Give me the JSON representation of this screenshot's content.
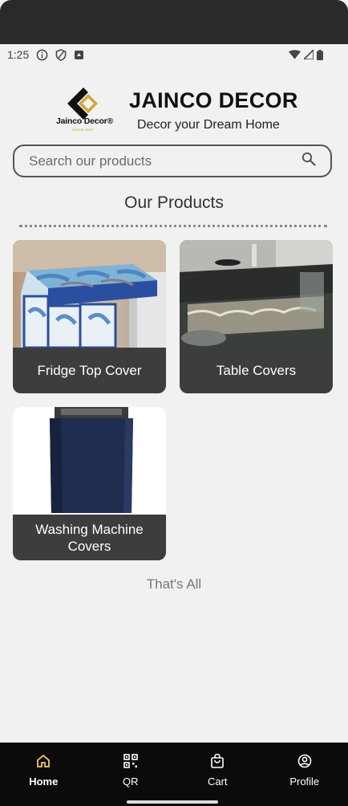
{
  "status_bar": {
    "time": "1:25",
    "left_icons": [
      "info-icon",
      "shield-icon",
      "notification-icon"
    ],
    "right_icons": [
      "wifi-icon",
      "signal-icon",
      "battery-icon"
    ]
  },
  "brand": {
    "logo_text": "Jainco Decor®",
    "logo_subtext": "SINCE 2007",
    "title": "JAINCO DECOR",
    "tagline": "Decor your Dream Home"
  },
  "search": {
    "placeholder": "Search our products",
    "icon": "search-icon"
  },
  "section": {
    "title": "Our Products"
  },
  "products": [
    {
      "label": "Fridge Top Cover"
    },
    {
      "label": "Table Covers"
    },
    {
      "label": "Washing Machine Covers"
    }
  ],
  "end_text": "That's All",
  "bottom_nav": {
    "active": "Home",
    "items": [
      {
        "label": "Home",
        "icon": "home-icon"
      },
      {
        "label": "QR",
        "icon": "qr-code-icon"
      },
      {
        "label": "Cart",
        "icon": "shopping-bag-icon"
      },
      {
        "label": "Profile",
        "icon": "profile-icon"
      }
    ]
  },
  "colors": {
    "background": "#f1f1f1",
    "card_label_bg": "#3d3d3d",
    "nav_bg": "#0b0b0b",
    "nav_active_icon": "#e0b85a",
    "logo_gold": "#d4a43a"
  }
}
